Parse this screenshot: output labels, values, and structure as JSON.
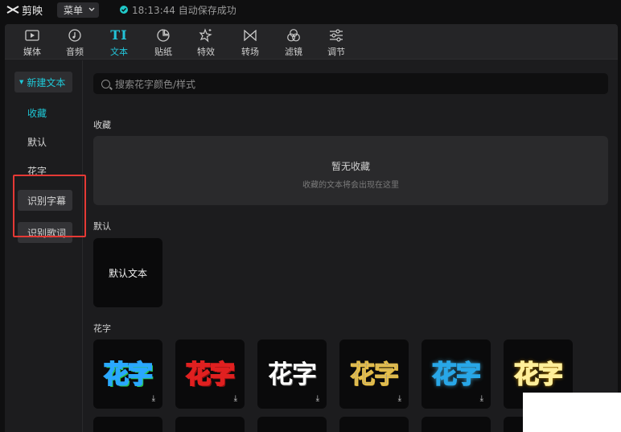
{
  "app": {
    "name": "剪映"
  },
  "titlebar": {
    "menu_label": "菜单",
    "status_text": "18:13:44 自动保存成功"
  },
  "toolbar": {
    "tools": [
      {
        "label": "媒体",
        "icon": "media-icon"
      },
      {
        "label": "音频",
        "icon": "audio-icon"
      },
      {
        "label": "文本",
        "icon": "text-icon",
        "active": true
      },
      {
        "label": "贴纸",
        "icon": "sticker-icon"
      },
      {
        "label": "特效",
        "icon": "effects-icon"
      },
      {
        "label": "转场",
        "icon": "transition-icon"
      },
      {
        "label": "滤镜",
        "icon": "filter-icon"
      },
      {
        "label": "调节",
        "icon": "adjust-icon"
      }
    ]
  },
  "sidebar": {
    "new_text": "新建文本",
    "items": [
      "收藏",
      "默认",
      "花字",
      "识别字幕",
      "识别歌词"
    ]
  },
  "content": {
    "search_placeholder": "搜索花字颜色/样式",
    "favorites": {
      "title": "收藏",
      "empty_title": "暂无收藏",
      "empty_sub": "收藏的文本将会出现在这里"
    },
    "default": {
      "title": "默认",
      "card_label": "默认文本"
    },
    "huazi": {
      "title": "花字",
      "sample_text": "花字"
    }
  },
  "colors": {
    "accent": "#1ec7d6",
    "highlight_box": "#e53935"
  }
}
